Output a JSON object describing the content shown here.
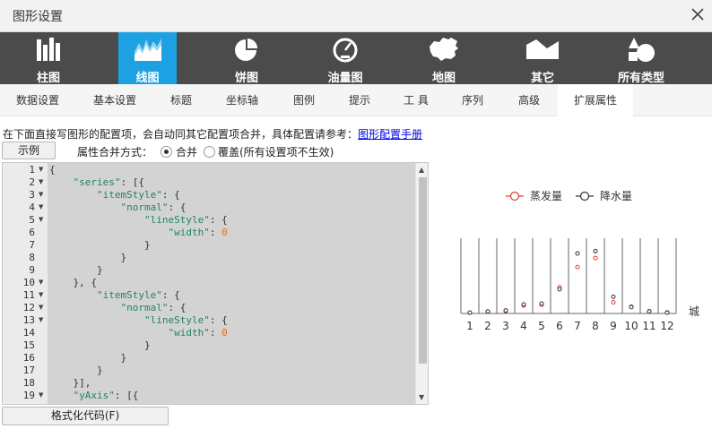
{
  "window": {
    "title": "图形设置"
  },
  "chart_types": [
    {
      "label": "柱图",
      "icon": "bar-chart-icon",
      "active": false
    },
    {
      "label": "线图",
      "icon": "line-chart-icon",
      "active": true
    },
    {
      "label": "饼图",
      "icon": "pie-chart-icon",
      "active": false
    },
    {
      "label": "油量图",
      "icon": "gauge-icon",
      "active": false
    },
    {
      "label": "地图",
      "icon": "map-icon",
      "active": false
    },
    {
      "label": "其它",
      "icon": "mountain-icon",
      "active": false
    },
    {
      "label": "所有类型",
      "icon": "shapes-icon",
      "active": false
    }
  ],
  "tabs": [
    {
      "label": "数据设置",
      "active": false
    },
    {
      "label": "基本设置",
      "active": false
    },
    {
      "label": "标题",
      "active": false
    },
    {
      "label": "坐标轴",
      "active": false
    },
    {
      "label": "图例",
      "active": false
    },
    {
      "label": "提示",
      "active": false
    },
    {
      "label": "工 具",
      "active": false
    },
    {
      "label": "序列",
      "active": false
    },
    {
      "label": "高级",
      "active": false
    },
    {
      "label": "扩展属性",
      "active": true
    }
  ],
  "description": {
    "text": "在下面直接写图形的配置项，会自动同其它配置项合并，具体配置请参考：",
    "link": "图形配置手册"
  },
  "example_button": "示例",
  "merge": {
    "label": "属性合并方式：",
    "options": [
      {
        "label": "合并",
        "checked": true
      },
      {
        "label": "覆盖(所有设置项不生效)",
        "checked": false
      }
    ]
  },
  "editor": {
    "lines": [
      {
        "no": "1",
        "fold": true,
        "text": "{"
      },
      {
        "no": "2",
        "fold": true,
        "text": "    \"series\": [{"
      },
      {
        "no": "3",
        "fold": true,
        "text": "        \"itemStyle\": {"
      },
      {
        "no": "4",
        "fold": true,
        "text": "            \"normal\": {"
      },
      {
        "no": "5",
        "fold": true,
        "text": "                \"lineStyle\": {"
      },
      {
        "no": "6",
        "fold": false,
        "text": "                    \"width\": 0"
      },
      {
        "no": "7",
        "fold": false,
        "text": "                }"
      },
      {
        "no": "8",
        "fold": false,
        "text": "            }"
      },
      {
        "no": "9",
        "fold": false,
        "text": "        }"
      },
      {
        "no": "10",
        "fold": true,
        "text": "    }, {"
      },
      {
        "no": "11",
        "fold": true,
        "text": "        \"itemStyle\": {"
      },
      {
        "no": "12",
        "fold": true,
        "text": "            \"normal\": {"
      },
      {
        "no": "13",
        "fold": true,
        "text": "                \"lineStyle\": {"
      },
      {
        "no": "14",
        "fold": false,
        "text": "                    \"width\": 0"
      },
      {
        "no": "15",
        "fold": false,
        "text": "                }"
      },
      {
        "no": "16",
        "fold": false,
        "text": "            }"
      },
      {
        "no": "17",
        "fold": false,
        "text": "        }"
      },
      {
        "no": "18",
        "fold": false,
        "text": "    }],"
      },
      {
        "no": "19",
        "fold": true,
        "text": "    \"yAxis\": [{"
      }
    ]
  },
  "format_button": "格式化代码(F)",
  "chart_data": {
    "type": "scatter",
    "categories": [
      "1",
      "2",
      "3",
      "4",
      "5",
      "6",
      "7",
      "8",
      "9",
      "10",
      "11",
      "12"
    ],
    "xlabel": "城",
    "series": [
      {
        "name": "蒸发量",
        "color": "#e03a3a",
        "values": [
          2.0,
          4.9,
          7.0,
          23.2,
          25.6,
          76.7,
          135.6,
          162.2,
          32.6,
          20.0,
          6.4,
          3.3
        ]
      },
      {
        "name": "降水量",
        "color": "#333333",
        "values": [
          2.6,
          5.9,
          9.0,
          26.4,
          28.7,
          70.7,
          175.6,
          182.2,
          48.7,
          18.8,
          6.0,
          2.3
        ]
      }
    ],
    "ylim": [
      0,
      220
    ],
    "grid": "vertical"
  }
}
